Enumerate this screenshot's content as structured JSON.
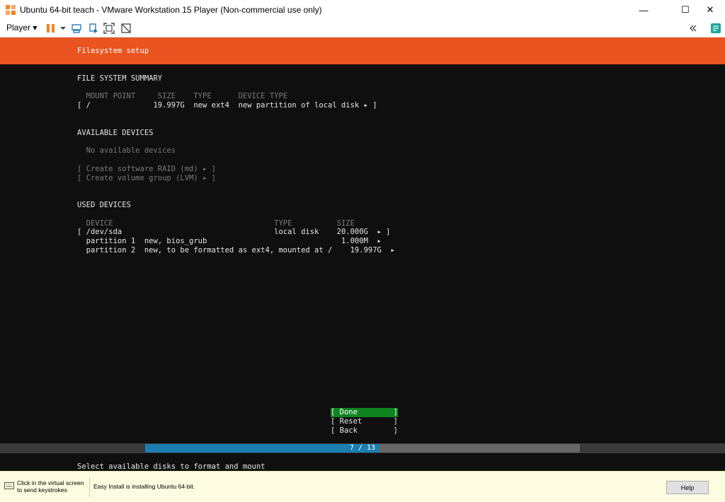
{
  "window": {
    "title": "Ubuntu 64-bit teach - VMware Workstation 15 Player (Non-commercial use only)",
    "minimize": "—",
    "maximize": "☐",
    "close": "✕"
  },
  "toolbar": {
    "player_label": "Player ▾",
    "icons": [
      "pause-icon",
      "send-keys-icon",
      "removable-devices-icon",
      "fullscreen-icon",
      "unity-icon",
      "collapse-icon",
      "vm-library-icon"
    ],
    "accent": "#f58220"
  },
  "installer": {
    "header": "Filesystem setup",
    "header_color": "#e95420",
    "fs_summary": {
      "heading": "FILE SYSTEM SUMMARY",
      "columns": "  MOUNT POINT     SIZE    TYPE      DEVICE TYPE",
      "row": "[ /              19.997G  new ext4  new partition of local disk ▸ ]"
    },
    "available": {
      "heading": "AVAILABLE DEVICES",
      "none": "  No available devices",
      "raid": "[ Create software RAID (md) ▸ ]",
      "lvm": "[ Create volume group (LVM) ▸ ]"
    },
    "used": {
      "heading": "USED DEVICES",
      "columns": "  DEVICE                                    TYPE          SIZE",
      "rows": [
        "[ /dev/sda                                  local disk    20.000G  ▸ ]",
        "  partition 1  new, bios_grub                              1.000M  ▸",
        "  partition 2  new, to be formatted as ext4, mounted at /    19.997G  ▸"
      ]
    },
    "buttons": {
      "done": "[ Done        ]",
      "reset": "[ Reset       ]",
      "back": "[ Back        ]"
    },
    "progress": {
      "label": "7 / 13",
      "current": 7,
      "total": 13
    },
    "footer": "Select available disks to format and mount"
  },
  "statusbar": {
    "hint": "Click in the virtual screen\nto send keystrokes",
    "message": "Easy Install is installing Ubuntu 64-bit.",
    "help": "Help"
  }
}
